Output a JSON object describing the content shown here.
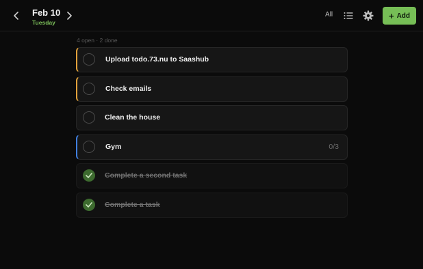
{
  "header": {
    "date": "Feb 10",
    "weekday": "Tuesday",
    "filter_label": "All",
    "add_label": "Add",
    "accent_color": "#76be56"
  },
  "summary": "4 open · 2 done",
  "tasks": [
    {
      "title": "Upload todo.73.nu to Saashub",
      "done": false,
      "accent": "#e2a23b"
    },
    {
      "title": "Check emails",
      "done": false,
      "accent": "#e2a23b"
    },
    {
      "title": "Clean the house",
      "done": false,
      "accent": ""
    },
    {
      "title": "Gym",
      "done": false,
      "accent": "#3f7fe0",
      "subtasks": "0/3"
    },
    {
      "title": "Complete a second task",
      "done": true,
      "accent": ""
    },
    {
      "title": "Complete a task",
      "done": true,
      "accent": ""
    }
  ],
  "icons": {
    "prev": "chevron-left-icon",
    "next": "chevron-right-icon",
    "list": "list-icon",
    "settings": "gear-icon",
    "add": "plus-icon",
    "check": "checkmark-icon"
  }
}
